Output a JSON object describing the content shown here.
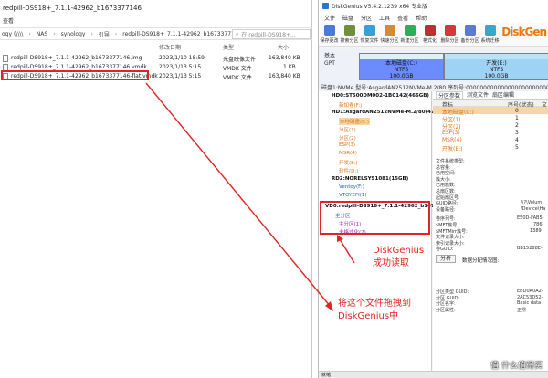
{
  "explorer": {
    "title": "redpill-DS918+_7.1.1-42962_b1673377146",
    "ribbon_tab": "查看",
    "breadcrumbs": [
      "ogy (\\\\\\\\",
      "NAS",
      "synology",
      "引导",
      "redpill-DS918+_7.1.1-42962_b1673377146"
    ],
    "search_placeholder": "在 redpill-DS918+...",
    "columns": {
      "date": "修改日期",
      "type": "类型",
      "size": "大小"
    },
    "files": [
      {
        "name": "redpill-DS918+_7.1.1-42962_b1673377146.img",
        "date": "2023/1/10 18:59",
        "type": "光盘映像文件",
        "size": "163,840 KB"
      },
      {
        "name": "redpill-DS918+_7.1.1-42962_b1673377146.vmdk",
        "date": "2023/1/13 5:15",
        "type": "VMDK 文件",
        "size": "1 KB"
      },
      {
        "name": "redpill-DS918+_7.1.1-42962_b1673377146-flat.vmdk",
        "date": "2023/1/13 5:15",
        "type": "VMDK 文件",
        "size": "163,840 KB"
      }
    ]
  },
  "dg": {
    "title": "DiskGenius V5.4.2.1239 x64 专业版",
    "menu": [
      "文件",
      "磁盘",
      "分区",
      "工具",
      "查看",
      "帮助"
    ],
    "toolbar": [
      {
        "label": "保存更改",
        "color": "#4b7bd6"
      },
      {
        "label": "搜索分区",
        "color": "#6f8f3a"
      },
      {
        "label": "恢复文件",
        "color": "#3a9fd6"
      },
      {
        "label": "快速分区",
        "color": "#d6893a"
      },
      {
        "label": "新建分区",
        "color": "#2fae5a"
      },
      {
        "label": "格式化",
        "color": "#b83232"
      },
      {
        "label": "删除分区",
        "color": "#cf3a3a"
      },
      {
        "label": "备份分区",
        "color": "#5a7ad6"
      },
      {
        "label": "系统迁移",
        "color": "#3aa6c9"
      }
    ],
    "brand": "DiskGen",
    "diskmap": {
      "disk_label": [
        "基本",
        "GPT"
      ],
      "partitions": [
        {
          "name": "本地磁盘(C:)",
          "fs": "NTFS",
          "size": "100.0GB"
        },
        {
          "name": "开发(E:)",
          "fs": "NTFS",
          "size": "100.0GB"
        }
      ]
    },
    "info_line": "磁盘1:NVMe 型号:AsgardAN2512NVMe-M.2/80 序列号:0000000000000000000000001",
    "tree": [
      {
        "text": "HD0:ST500DM002-1BC142(466GB)",
        "style": "bold"
      },
      {
        "text": "新加卷(F:)",
        "style": "orange"
      },
      {
        "text": "HD1:AsgardAN2512NVMe-M.2/80(477GB)",
        "style": "bold"
      },
      {
        "text": "本地磁盘(C:)",
        "style": "orange sel"
      },
      {
        "text": "分区(1)",
        "style": "orange"
      },
      {
        "text": "分区(2)",
        "style": "orange"
      },
      {
        "text": "ESP(3)",
        "style": "orange"
      },
      {
        "text": "MSR(4)",
        "style": "orange"
      },
      {
        "text": "开发(E:)",
        "style": "orange"
      },
      {
        "text": "软件(D:)",
        "style": "orange"
      },
      {
        "text": "RD2:NORELSYS1081(15GB)",
        "style": "bold"
      },
      {
        "text": "Ventoy(F:)",
        "style": "blue"
      },
      {
        "text": "VTOYEFI(1)",
        "style": "blue"
      },
      {
        "text": "VD0:redpill-DS918+_7.1.1-42962_b1673",
        "style": "bold"
      },
      {
        "text": "主分区",
        "style": "blue"
      },
      {
        "text": "主分区(1)",
        "style": "purple"
      },
      {
        "text": "未格式化(2)",
        "style": "purple"
      }
    ],
    "tabs": [
      "分区参数",
      "浏览文件",
      "扇区编辑"
    ],
    "plist_header": {
      "name": "卷标",
      "num": "序号(状态)",
      "type": "文"
    },
    "plist": [
      {
        "name": "本地磁盘(C:)",
        "num": "0",
        "type": ""
      },
      {
        "name": "分区(1)",
        "num": "1",
        "type": ""
      },
      {
        "name": "分区(2)",
        "num": "2",
        "type": ""
      },
      {
        "name": "ESP(3)",
        "num": "3",
        "type": ""
      },
      {
        "name": "MSR(4)",
        "num": "4",
        "type": ""
      },
      {
        "name": "开发(E:)",
        "num": "5",
        "type": ""
      }
    ],
    "fs_title": "文件系统类型:",
    "fs_rows": [
      {
        "k": "总容量:",
        "v": ""
      },
      {
        "k": "已用空间:",
        "v": ""
      },
      {
        "k": "簇大小:",
        "v": ""
      },
      {
        "k": "已用簇数:",
        "v": ""
      },
      {
        "k": "总扇区数:",
        "v": ""
      },
      {
        "k": "起始扇区号:",
        "v": ""
      },
      {
        "k": "GUID路径:",
        "v": "\\\\?\\Volum"
      },
      {
        "k": "设备路径:",
        "v": "\\Device\\Ha"
      }
    ],
    "fs_rows2": [
      {
        "k": "卷序列号:",
        "v": "E50D-FAB5-"
      },
      {
        "k": "$MFT簇号:",
        "v": "786"
      },
      {
        "k": "$MFTMirr簇号:",
        "v": "1389"
      },
      {
        "k": "文件记录大小:",
        "v": ""
      },
      {
        "k": "索引记录大小:",
        "v": ""
      },
      {
        "k": "卷GUID:",
        "v": "BB15288E-"
      }
    ],
    "analyze_btn": "分析",
    "analyze_caption": "数据分配情况图:",
    "fs_rows3": [
      {
        "k": "分区类型 GUID:",
        "v": "EBD0A0A2-"
      },
      {
        "k": "分区 GUID:",
        "v": "2AC53D52-"
      },
      {
        "k": "分区名字:",
        "v": "Basic data"
      },
      {
        "k": "分区属性:",
        "v": "正常"
      }
    ],
    "status": "就绪"
  },
  "annotations": {
    "dg_read": [
      "DiskGenius",
      "成功读取"
    ],
    "drag_hint": [
      "将这个文件拖拽到",
      "DiskGenius中"
    ]
  },
  "watermark": "值 什么值得买"
}
